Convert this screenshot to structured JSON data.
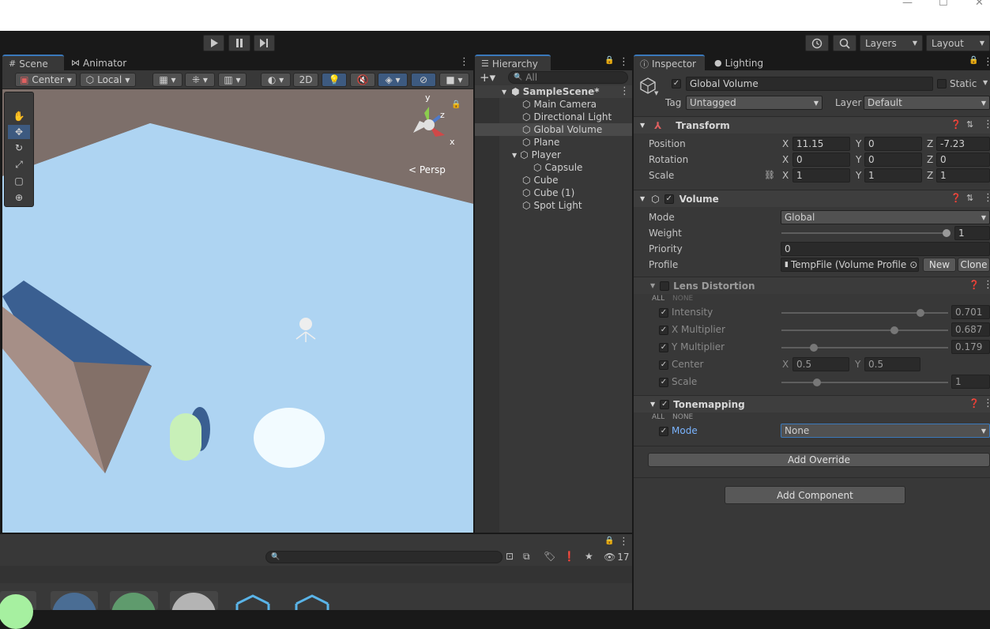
{
  "toolbar": {
    "layers_label": "Layers",
    "layout_label": "Layout"
  },
  "scene": {
    "tab_scene": "Scene",
    "tab_animator": "Animator",
    "pivot_label": "Center",
    "space_label": "Local",
    "mode_2d": "2D",
    "persp_label": "Persp",
    "gizmo_axes": [
      "y",
      "z",
      "x"
    ]
  },
  "hierarchy": {
    "tab": "Hierarchy",
    "search_placeholder": "All",
    "scene_name": "SampleScene*",
    "items": [
      {
        "label": "Main Camera"
      },
      {
        "label": "Directional Light"
      },
      {
        "label": "Global Volume"
      },
      {
        "label": "Plane"
      },
      {
        "label": "Player"
      },
      {
        "label": "Capsule"
      },
      {
        "label": "Cube"
      },
      {
        "label": "Cube (1)"
      },
      {
        "label": "Spot Light"
      }
    ]
  },
  "inspector": {
    "tab_inspector": "Inspector",
    "tab_lighting": "Lighting",
    "object_name": "Global Volume",
    "static_label": "Static",
    "tag_label": "Tag",
    "tag_value": "Untagged",
    "layer_label": "Layer",
    "layer_value": "Default",
    "transform": {
      "title": "Transform",
      "position_label": "Position",
      "rotation_label": "Rotation",
      "scale_label": "Scale",
      "axis_x": "X",
      "axis_y": "Y",
      "axis_z": "Z",
      "position": [
        "11.15",
        "0",
        "-7.23"
      ],
      "rotation": [
        "0",
        "0",
        "0"
      ],
      "scale": [
        "1",
        "1",
        "1"
      ]
    },
    "volume": {
      "title": "Volume",
      "mode_label": "Mode",
      "mode_value": "Global",
      "weight_label": "Weight",
      "weight_value": "1",
      "priority_label": "Priority",
      "priority_value": "0",
      "profile_label": "Profile",
      "profile_value": "TempFile (Volume Profile",
      "new_label": "New",
      "clone_label": "Clone"
    },
    "lens": {
      "title": "Lens Distortion",
      "all": "ALL",
      "none": "NONE",
      "intensity_label": "Intensity",
      "intensity": "0.701",
      "xmul_label": "X Multiplier",
      "xmul": "0.687",
      "ymul_label": "Y Multiplier",
      "ymul": "0.179",
      "center_label": "Center",
      "center_x": "0.5",
      "center_y": "0.5",
      "scale_label": "Scale",
      "scale": "1"
    },
    "tonemapping": {
      "title": "Tonemapping",
      "all": "ALL",
      "none": "NONE",
      "mode_label": "Mode",
      "mode_value": "None"
    },
    "add_override": "Add Override",
    "add_component": "Add Component"
  },
  "project": {
    "hidden_count": "17"
  }
}
